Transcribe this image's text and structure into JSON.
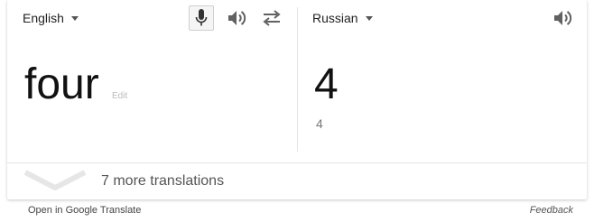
{
  "source": {
    "language": "English",
    "text": "four",
    "edit_label": "Edit",
    "icons": [
      "chevron-down-icon",
      "microphone-icon",
      "speaker-icon",
      "swap-icon"
    ]
  },
  "target": {
    "language": "Russian",
    "text": "4",
    "sub_text": "4",
    "icons": [
      "chevron-down-icon",
      "speaker-icon"
    ]
  },
  "more_translations": {
    "label": "7 more translations",
    "icon": "expand-chevron-icon"
  },
  "footer": {
    "open_link": "Open in Google Translate",
    "feedback": "Feedback"
  },
  "colors": {
    "divider": "#e5e5e5",
    "muted_text": "#777777",
    "icon": "#616161"
  }
}
